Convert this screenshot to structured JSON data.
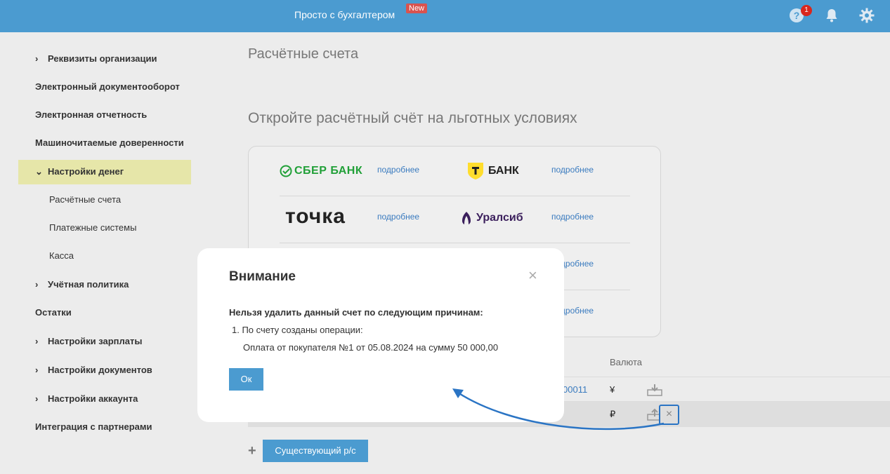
{
  "header": {
    "title": "Просто с бухгалтером",
    "new_badge": "New",
    "help_count": "1"
  },
  "sidebar": {
    "items": [
      {
        "label": "Реквизиты организации"
      },
      {
        "label": "Электронный документооборот"
      },
      {
        "label": "Электронная отчетность"
      },
      {
        "label": "Машиночитаемые доверенности"
      },
      {
        "label": "Настройки денег"
      },
      {
        "label": "Расчётные счета"
      },
      {
        "label": "Платежные системы"
      },
      {
        "label": "Касса"
      },
      {
        "label": "Учётная политика"
      },
      {
        "label": "Остатки"
      },
      {
        "label": "Настройки зарплаты"
      },
      {
        "label": "Настройки документов"
      },
      {
        "label": "Настройки аккаунта"
      },
      {
        "label": "Интеграция с партнерами"
      }
    ]
  },
  "main": {
    "page_title": "Расчётные счета",
    "promo_title": "Откройте расчётный счёт на льготных условиях",
    "banks": [
      {
        "name": "СБЕР БАНК",
        "link": "подробнее"
      },
      {
        "name": "БАНК",
        "link": "подробнее"
      },
      {
        "name": "точка",
        "link": "подробнее"
      },
      {
        "name": "Уралсиб",
        "link": "подробнее"
      },
      {
        "link": "подробнее"
      },
      {
        "link": "подробнее"
      }
    ],
    "columns": {
      "currency": "Валюта"
    },
    "accounts": [
      {
        "number_fragment": "00011",
        "currency": "¥"
      },
      {
        "currency": "₽"
      }
    ],
    "delete_icon": "×",
    "plus": "+",
    "existing_button": "Существующий р/с"
  },
  "dialog": {
    "title": "Внимание",
    "close": "×",
    "reason": "Нельзя удалить данный счет по следующим причинам:",
    "item": "1. По счету созданы операции:",
    "detail": "Оплата от покупателя №1 от 05.08.2024 на сумму 50 000,00",
    "ok": "Ок"
  },
  "colors": {
    "header": "#4b9bd0",
    "active_sidebar": "#e6e6a9",
    "link": "#3a7bbf",
    "arrow": "#2a74c4"
  }
}
